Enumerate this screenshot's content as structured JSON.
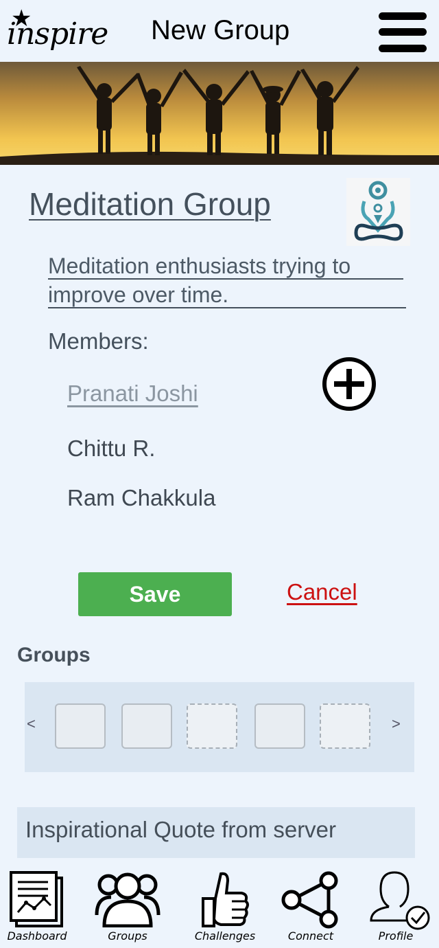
{
  "header": {
    "logo_text": "inspire",
    "title": "New Group",
    "menu_icon": "hamburger-menu-icon"
  },
  "banner": {
    "image": "group-of-children-silhouette-at-sunset"
  },
  "group": {
    "name": "Meditation Group",
    "avatar_icon": "meditation-lotus-icon",
    "description_line1": "Meditation enthusiasts trying to",
    "description_line2": "improve over time.",
    "members_label": "Members:",
    "members": [
      "Pranati Joshi",
      "Chittu R.",
      "Ram Chakkula"
    ],
    "add_member_icon": "plus-circle-icon"
  },
  "actions": {
    "save_label": "Save",
    "cancel_label": "Cancel"
  },
  "groups_section": {
    "title": "Groups",
    "prev": "<",
    "next": ">"
  },
  "quote": {
    "text": "Inspirational Quote from server"
  },
  "nav": {
    "items": [
      {
        "label": "Dashboard",
        "icon": "dashboard-chart-icon"
      },
      {
        "label": "Groups",
        "icon": "people-group-icon"
      },
      {
        "label": "Challenges",
        "icon": "thumbs-up-icon"
      },
      {
        "label": "Connect",
        "icon": "share-network-icon"
      },
      {
        "label": "Profile",
        "icon": "profile-check-icon"
      }
    ]
  },
  "colors": {
    "background": "#edf4fc",
    "save_button": "#4caf50",
    "cancel_link": "#cc1111",
    "panel": "#dae6f2"
  }
}
